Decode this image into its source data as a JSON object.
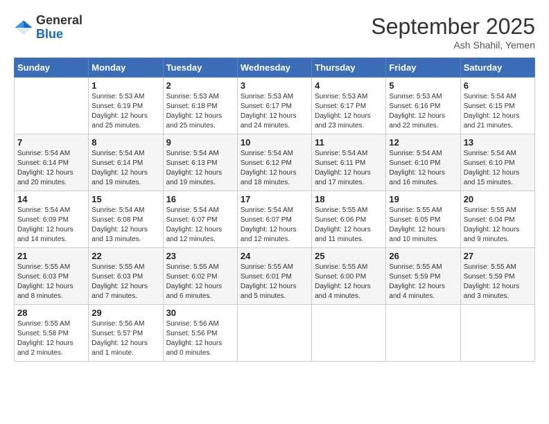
{
  "header": {
    "logo_general": "General",
    "logo_blue": "Blue",
    "month_year": "September 2025",
    "location": "Ash Shahil, Yemen"
  },
  "days_of_week": [
    "Sunday",
    "Monday",
    "Tuesday",
    "Wednesday",
    "Thursday",
    "Friday",
    "Saturday"
  ],
  "weeks": [
    [
      {
        "day": null,
        "info": null
      },
      {
        "day": "1",
        "info": "Sunrise: 5:53 AM\nSunset: 6:19 PM\nDaylight: 12 hours\nand 25 minutes."
      },
      {
        "day": "2",
        "info": "Sunrise: 5:53 AM\nSunset: 6:18 PM\nDaylight: 12 hours\nand 25 minutes."
      },
      {
        "day": "3",
        "info": "Sunrise: 5:53 AM\nSunset: 6:17 PM\nDaylight: 12 hours\nand 24 minutes."
      },
      {
        "day": "4",
        "info": "Sunrise: 5:53 AM\nSunset: 6:17 PM\nDaylight: 12 hours\nand 23 minutes."
      },
      {
        "day": "5",
        "info": "Sunrise: 5:53 AM\nSunset: 6:16 PM\nDaylight: 12 hours\nand 22 minutes."
      },
      {
        "day": "6",
        "info": "Sunrise: 5:54 AM\nSunset: 6:15 PM\nDaylight: 12 hours\nand 21 minutes."
      }
    ],
    [
      {
        "day": "7",
        "info": "Sunrise: 5:54 AM\nSunset: 6:14 PM\nDaylight: 12 hours\nand 20 minutes."
      },
      {
        "day": "8",
        "info": "Sunrise: 5:54 AM\nSunset: 6:14 PM\nDaylight: 12 hours\nand 19 minutes."
      },
      {
        "day": "9",
        "info": "Sunrise: 5:54 AM\nSunset: 6:13 PM\nDaylight: 12 hours\nand 19 minutes."
      },
      {
        "day": "10",
        "info": "Sunrise: 5:54 AM\nSunset: 6:12 PM\nDaylight: 12 hours\nand 18 minutes."
      },
      {
        "day": "11",
        "info": "Sunrise: 5:54 AM\nSunset: 6:11 PM\nDaylight: 12 hours\nand 17 minutes."
      },
      {
        "day": "12",
        "info": "Sunrise: 5:54 AM\nSunset: 6:10 PM\nDaylight: 12 hours\nand 16 minutes."
      },
      {
        "day": "13",
        "info": "Sunrise: 5:54 AM\nSunset: 6:10 PM\nDaylight: 12 hours\nand 15 minutes."
      }
    ],
    [
      {
        "day": "14",
        "info": "Sunrise: 5:54 AM\nSunset: 6:09 PM\nDaylight: 12 hours\nand 14 minutes."
      },
      {
        "day": "15",
        "info": "Sunrise: 5:54 AM\nSunset: 6:08 PM\nDaylight: 12 hours\nand 13 minutes."
      },
      {
        "day": "16",
        "info": "Sunrise: 5:54 AM\nSunset: 6:07 PM\nDaylight: 12 hours\nand 12 minutes."
      },
      {
        "day": "17",
        "info": "Sunrise: 5:54 AM\nSunset: 6:07 PM\nDaylight: 12 hours\nand 12 minutes."
      },
      {
        "day": "18",
        "info": "Sunrise: 5:55 AM\nSunset: 6:06 PM\nDaylight: 12 hours\nand 11 minutes."
      },
      {
        "day": "19",
        "info": "Sunrise: 5:55 AM\nSunset: 6:05 PM\nDaylight: 12 hours\nand 10 minutes."
      },
      {
        "day": "20",
        "info": "Sunrise: 5:55 AM\nSunset: 6:04 PM\nDaylight: 12 hours\nand 9 minutes."
      }
    ],
    [
      {
        "day": "21",
        "info": "Sunrise: 5:55 AM\nSunset: 6:03 PM\nDaylight: 12 hours\nand 8 minutes."
      },
      {
        "day": "22",
        "info": "Sunrise: 5:55 AM\nSunset: 6:03 PM\nDaylight: 12 hours\nand 7 minutes."
      },
      {
        "day": "23",
        "info": "Sunrise: 5:55 AM\nSunset: 6:02 PM\nDaylight: 12 hours\nand 6 minutes."
      },
      {
        "day": "24",
        "info": "Sunrise: 5:55 AM\nSunset: 6:01 PM\nDaylight: 12 hours\nand 5 minutes."
      },
      {
        "day": "25",
        "info": "Sunrise: 5:55 AM\nSunset: 6:00 PM\nDaylight: 12 hours\nand 4 minutes."
      },
      {
        "day": "26",
        "info": "Sunrise: 5:55 AM\nSunset: 5:59 PM\nDaylight: 12 hours\nand 4 minutes."
      },
      {
        "day": "27",
        "info": "Sunrise: 5:55 AM\nSunset: 5:59 PM\nDaylight: 12 hours\nand 3 minutes."
      }
    ],
    [
      {
        "day": "28",
        "info": "Sunrise: 5:55 AM\nSunset: 5:58 PM\nDaylight: 12 hours\nand 2 minutes."
      },
      {
        "day": "29",
        "info": "Sunrise: 5:56 AM\nSunset: 5:57 PM\nDaylight: 12 hours\nand 1 minute."
      },
      {
        "day": "30",
        "info": "Sunrise: 5:56 AM\nSunset: 5:56 PM\nDaylight: 12 hours\nand 0 minutes."
      },
      {
        "day": null,
        "info": null
      },
      {
        "day": null,
        "info": null
      },
      {
        "day": null,
        "info": null
      },
      {
        "day": null,
        "info": null
      }
    ]
  ]
}
